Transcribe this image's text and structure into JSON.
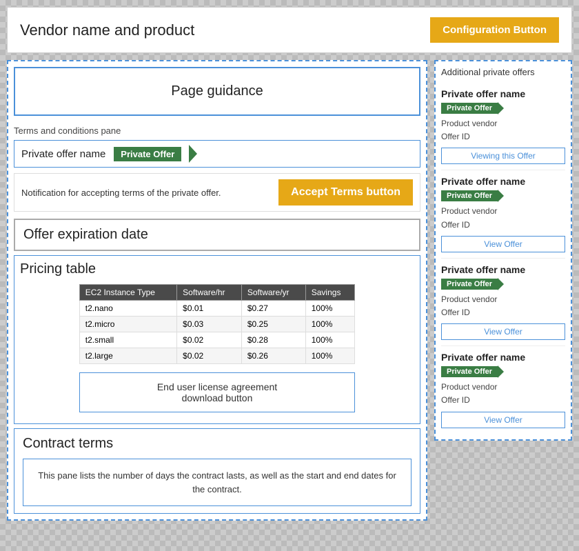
{
  "header": {
    "title": "Vendor name and product",
    "config_button_label": "Configuration Button"
  },
  "left_panel": {
    "page_guidance_label": "Page guidance",
    "terms_pane_label": "Terms and conditions pane",
    "offer_name_label": "Private offer name",
    "private_offer_badge": "Private Offer",
    "notification_text": "Notification for accepting terms of the private offer.",
    "accept_terms_label": "Accept Terms button",
    "expiration_title": "Offer expiration date",
    "pricing_title": "Pricing table",
    "pricing_table": {
      "headers": [
        "EC2 Instance Type",
        "Software/hr",
        "Software/yr",
        "Savings"
      ],
      "rows": [
        [
          "t2.nano",
          "$0.01",
          "$0.27",
          "100%"
        ],
        [
          "t2.micro",
          "$0.03",
          "$0.25",
          "100%"
        ],
        [
          "t2.small",
          "$0.02",
          "$0.28",
          "100%"
        ],
        [
          "t2.large",
          "$0.02",
          "$0.26",
          "100%"
        ]
      ]
    },
    "eula_button_label": "End user license agreement\ndownload button",
    "contract_title": "Contract terms",
    "contract_text": "This pane lists the number of days the contract lasts, as well as the start and end dates for the contract."
  },
  "right_panel": {
    "title": "Additional private offers",
    "offers": [
      {
        "name": "Private offer name",
        "badge": "Private Offer",
        "vendor": "Product vendor",
        "offer_id": "Offer ID",
        "button_label": "Viewing this Offer",
        "button_type": "viewing"
      },
      {
        "name": "Private offer name",
        "badge": "Private Offer",
        "vendor": "Product vendor",
        "offer_id": "Offer ID",
        "button_label": "View Offer",
        "button_type": "normal"
      },
      {
        "name": "Private offer name",
        "badge": "Private Offer",
        "vendor": "Product vendor",
        "offer_id": "Offer ID",
        "button_label": "View Offer",
        "button_type": "normal"
      },
      {
        "name": "Private offer name",
        "badge": "Private Offer",
        "vendor": "Product vendor",
        "offer_id": "Offer ID",
        "button_label": "View Offer",
        "button_type": "normal"
      }
    ]
  }
}
